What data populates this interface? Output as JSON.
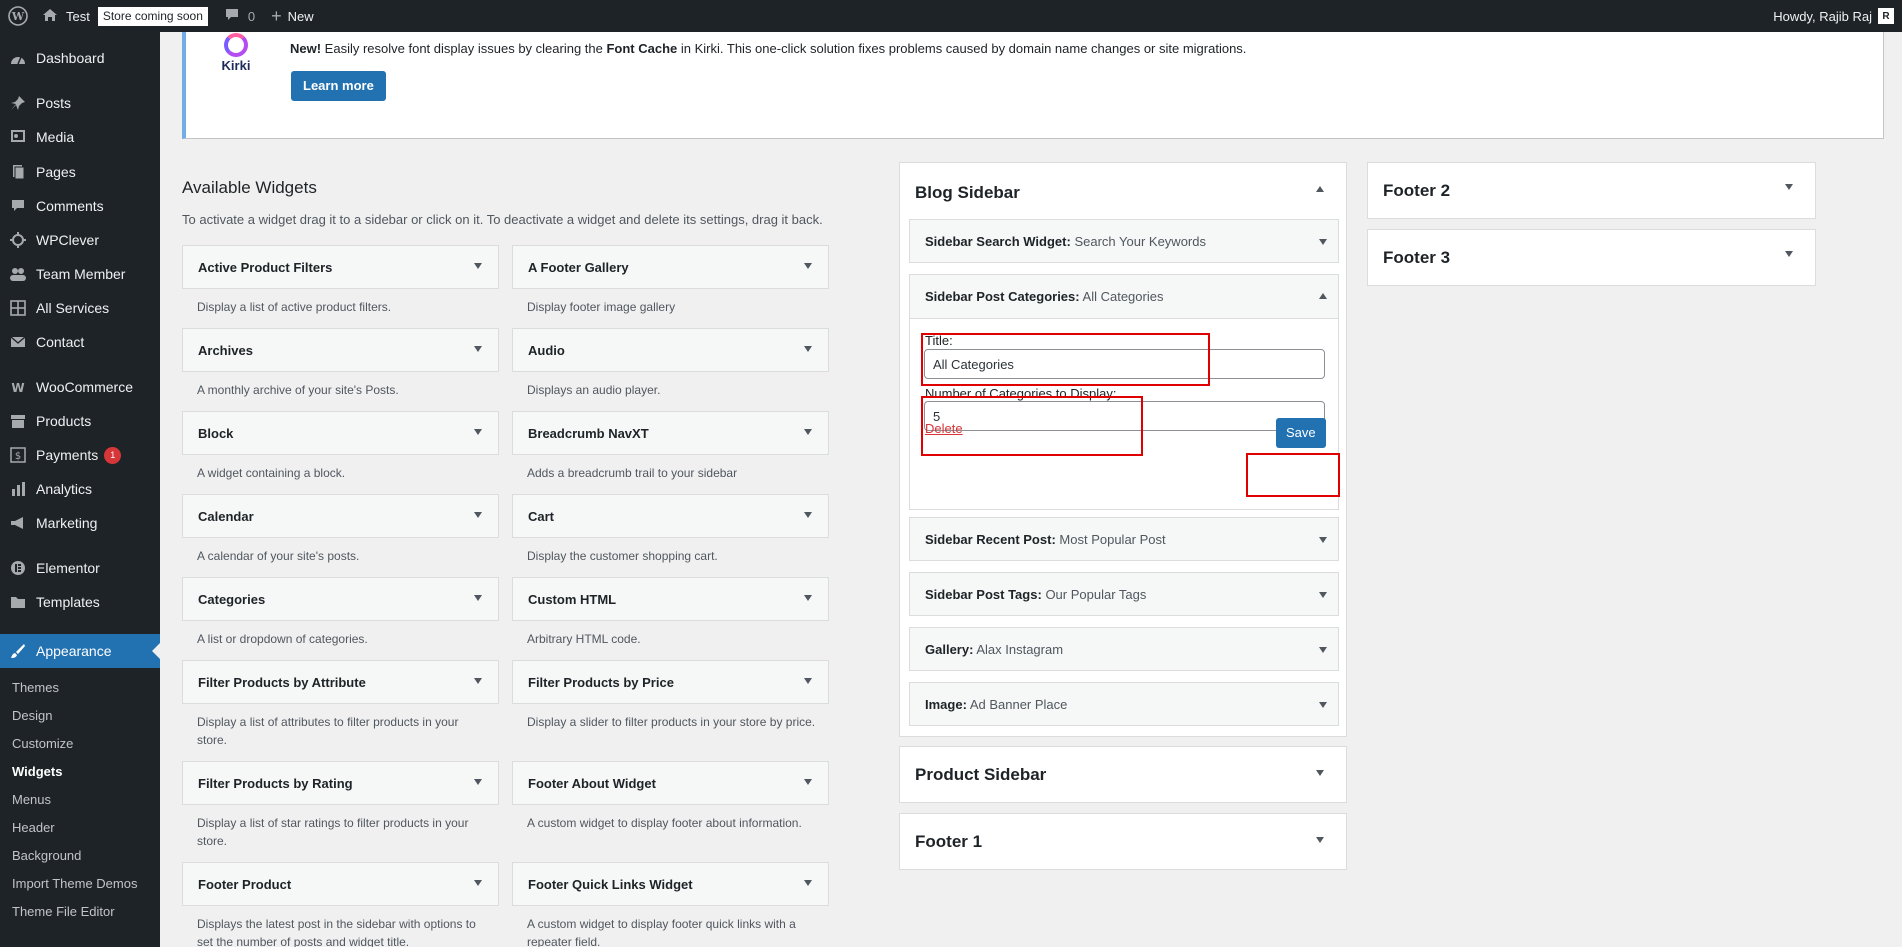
{
  "admin_bar": {
    "site_name": "Test",
    "store_badge": "Store coming soon",
    "comments_count": "0",
    "new_label": "New",
    "howdy": "Howdy, Rajib Raj",
    "avatar_letter": "R"
  },
  "menu": {
    "dashboard": "Dashboard",
    "posts": "Posts",
    "media": "Media",
    "pages": "Pages",
    "comments": "Comments",
    "wpclever": "WPClever",
    "team_member": "Team Member",
    "all_services": "All Services",
    "contact": "Contact",
    "woocommerce": "WooCommerce",
    "products": "Products",
    "payments": "Payments",
    "payments_badge": "1",
    "analytics": "Analytics",
    "marketing": "Marketing",
    "elementor": "Elementor",
    "templates": "Templates",
    "appearance": "Appearance",
    "sub": {
      "themes": "Themes",
      "design": "Design",
      "customize": "Customize",
      "widgets": "Widgets",
      "menus": "Menus",
      "header": "Header",
      "background": "Background",
      "import_theme_demos": "Import Theme Demos",
      "theme_file_editor": "Theme File Editor"
    }
  },
  "notice": {
    "logo_text": "Kirki",
    "message_new": "New!",
    "message_part1": " Easily resolve font display issues by clearing the ",
    "message_bold": "Font Cache",
    "message_part2": " in Kirki. This one-click solution fixes problems caused by domain name changes or site migrations.",
    "button": "Learn more"
  },
  "available_widgets": {
    "title": "Available Widgets",
    "description": "To activate a widget drag it to a sidebar or click on it. To deactivate a widget and delete its settings, drag it back.",
    "left": [
      {
        "name": "Active Product Filters",
        "desc": "Display a list of active product filters."
      },
      {
        "name": "Archives",
        "desc": "A monthly archive of your site's Posts."
      },
      {
        "name": "Block",
        "desc": "A widget containing a block."
      },
      {
        "name": "Calendar",
        "desc": "A calendar of your site's posts."
      },
      {
        "name": "Categories",
        "desc": "A list or dropdown of categories."
      },
      {
        "name": "Filter Products by Attribute",
        "desc": "Display a list of attributes to filter products in your store."
      },
      {
        "name": "Filter Products by Rating",
        "desc": "Display a list of star ratings to filter products in your store."
      },
      {
        "name": "Footer Product",
        "desc": "Displays the latest post in the sidebar with options to set the number of posts and widget title."
      }
    ],
    "right": [
      {
        "name": "A Footer Gallery",
        "desc": "Display footer image gallery"
      },
      {
        "name": "Audio",
        "desc": "Displays an audio player."
      },
      {
        "name": "Breadcrumb NavXT",
        "desc": "Adds a breadcrumb trail to your sidebar"
      },
      {
        "name": "Cart",
        "desc": "Display the customer shopping cart."
      },
      {
        "name": "Custom HTML",
        "desc": "Arbitrary HTML code."
      },
      {
        "name": "Filter Products by Price",
        "desc": "Display a slider to filter products in your store by price."
      },
      {
        "name": "Footer About Widget",
        "desc": "A custom widget to display footer about information."
      },
      {
        "name": "Footer Quick Links Widget",
        "desc": "A custom widget to display footer quick links with a repeater field."
      }
    ]
  },
  "blog_sidebar": {
    "title": "Blog Sidebar",
    "widgets": [
      {
        "name": "Sidebar Search Widget",
        "title": "Search Your Keywords"
      },
      {
        "name": "Sidebar Post Categories",
        "title": "All Categories"
      },
      {
        "name": "Sidebar Recent Post",
        "title": "Most Popular Post"
      },
      {
        "name": "Sidebar Post Tags",
        "title": "Our Popular Tags"
      },
      {
        "name": "Gallery",
        "title": "Alax Instagram"
      },
      {
        "name": "Image",
        "title": "Ad Banner Place"
      }
    ],
    "form": {
      "title_label": "Title:",
      "title_value": "All Categories",
      "count_label": "Number of Categories to Display:",
      "count_value": "5",
      "delete": "Delete",
      "save": "Save"
    }
  },
  "other_sidebars": {
    "product_sidebar": "Product Sidebar",
    "footer1": "Footer 1",
    "footer2": "Footer 2",
    "footer3": "Footer 3"
  },
  "colors": {
    "admin_dark": "#1d2327",
    "accent": "#2271b1",
    "highlight": "#e00000",
    "danger": "#d63638"
  }
}
